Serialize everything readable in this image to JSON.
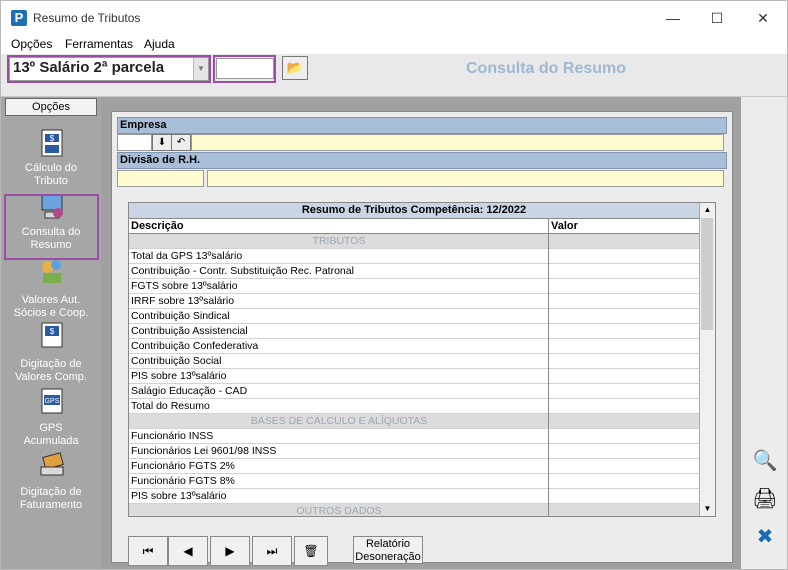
{
  "window": {
    "title": "Resumo de Tributos",
    "controls": [
      "—",
      "☐",
      "✕"
    ]
  },
  "menu": [
    "Opções",
    "Ferramentas",
    "Ajuda"
  ],
  "toolbar": {
    "combo_value": "13º Salário 2ª parcela",
    "small_input_value": "",
    "header_title": "Consulta do Resumo"
  },
  "sidebar": {
    "header": "Opções",
    "items": [
      {
        "line1": "Cálculo do",
        "line2": "Tributo"
      },
      {
        "line1": "Consulta do",
        "line2": "Resumo"
      },
      {
        "line1": "Valores Aut.",
        "line2": "Sócios e  Coop."
      },
      {
        "line1": "Digitação de",
        "line2": "Valores Comp."
      },
      {
        "line1": "GPS",
        "line2": "Acumulada"
      },
      {
        "line1": "Digitação de",
        "line2": "Faturamento"
      }
    ]
  },
  "form": {
    "empresa_label": "Empresa",
    "divisao_label": "Divisão de R.H."
  },
  "grid": {
    "title": "Resumo de Tributos Competência: 12/2022",
    "col_desc": "Descrição",
    "col_valor": "Valor",
    "rows": [
      {
        "desc": "TRIBUTOS",
        "section": true
      },
      {
        "desc": "Total da GPS 13ºsalário"
      },
      {
        "desc": "Contribuição - Contr. Substituição Rec. Patronal"
      },
      {
        "desc": "FGTS sobre 13ºsalário"
      },
      {
        "desc": "IRRF sobre 13ºsalário"
      },
      {
        "desc": "Contribuição Sindical"
      },
      {
        "desc": "Contribuição Assistencial"
      },
      {
        "desc": "Contribuição Confederativa"
      },
      {
        "desc": "Contribuição Social"
      },
      {
        "desc": "PIS sobre 13ºsalário"
      },
      {
        "desc": "Salágio Educação - CAD"
      },
      {
        "desc": "Total do Resumo"
      },
      {
        "desc": "BASES DE CÁLCULO E ALÍQUOTAS",
        "section": true
      },
      {
        "desc": "Funcionário INSS"
      },
      {
        "desc": "Funcionários Lei 9601/98 INSS"
      },
      {
        "desc": "Funcionário FGTS 2%"
      },
      {
        "desc": "Funcionário FGTS 8%"
      },
      {
        "desc": "PIS sobre 13ºsalário"
      },
      {
        "desc": "OUTROS DADOS",
        "section": true
      }
    ]
  },
  "nav": {
    "first": "⏮",
    "prev": "◀",
    "next": "▶",
    "last": "⏭",
    "report_line1": "Relatório",
    "report_line2": "Desoneração"
  }
}
